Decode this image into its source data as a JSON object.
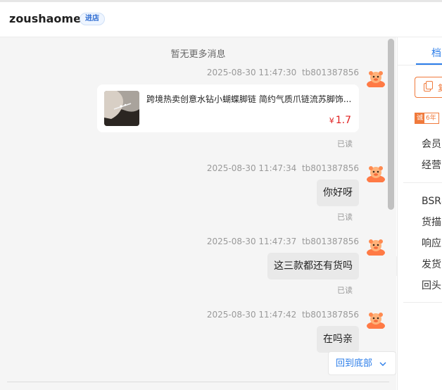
{
  "header": {
    "shop_name": "zoushaomei",
    "enter_badge": "进店"
  },
  "chat": {
    "no_more": "暂无更多消息",
    "messages": [
      {
        "time": "2025-08-30 11:47:30",
        "sender": "tb801387856",
        "kind": "product",
        "product_title": "跨境热卖创意水钻小蝴蝶脚链 简约气质爪链流苏脚饰...",
        "price_symbol": "¥",
        "price": "1.7",
        "status": "已读"
      },
      {
        "time": "2025-08-30 11:47:34",
        "sender": "tb801387856",
        "kind": "text",
        "text": "你好呀",
        "status": "已读"
      },
      {
        "time": "2025-08-30 11:47:37",
        "sender": "tb801387856",
        "kind": "text",
        "text": "这三款都还有货吗",
        "status": "已读"
      },
      {
        "time": "2025-08-30 11:47:42",
        "sender": "tb801387856",
        "kind": "text",
        "text": "在吗亲"
      }
    ],
    "scroll_bottom_label": "回到底部",
    "collapse_icon": "double-chevron-right-icon"
  },
  "side_panel": {
    "tab_label": "档",
    "action_text": "复",
    "years_mark": "诚",
    "years_text": "6年",
    "info_items": [
      "会员",
      "经营"
    ],
    "metric_items": [
      "BSR与",
      "货描",
      "响应",
      "发货",
      "回头"
    ]
  },
  "colors": {
    "accent_blue": "#2b7de9",
    "price_red": "#e02020",
    "orange": "#f07a3c",
    "bubble_gray": "#e9e9e9",
    "chat_bg": "#f5f5f5"
  }
}
